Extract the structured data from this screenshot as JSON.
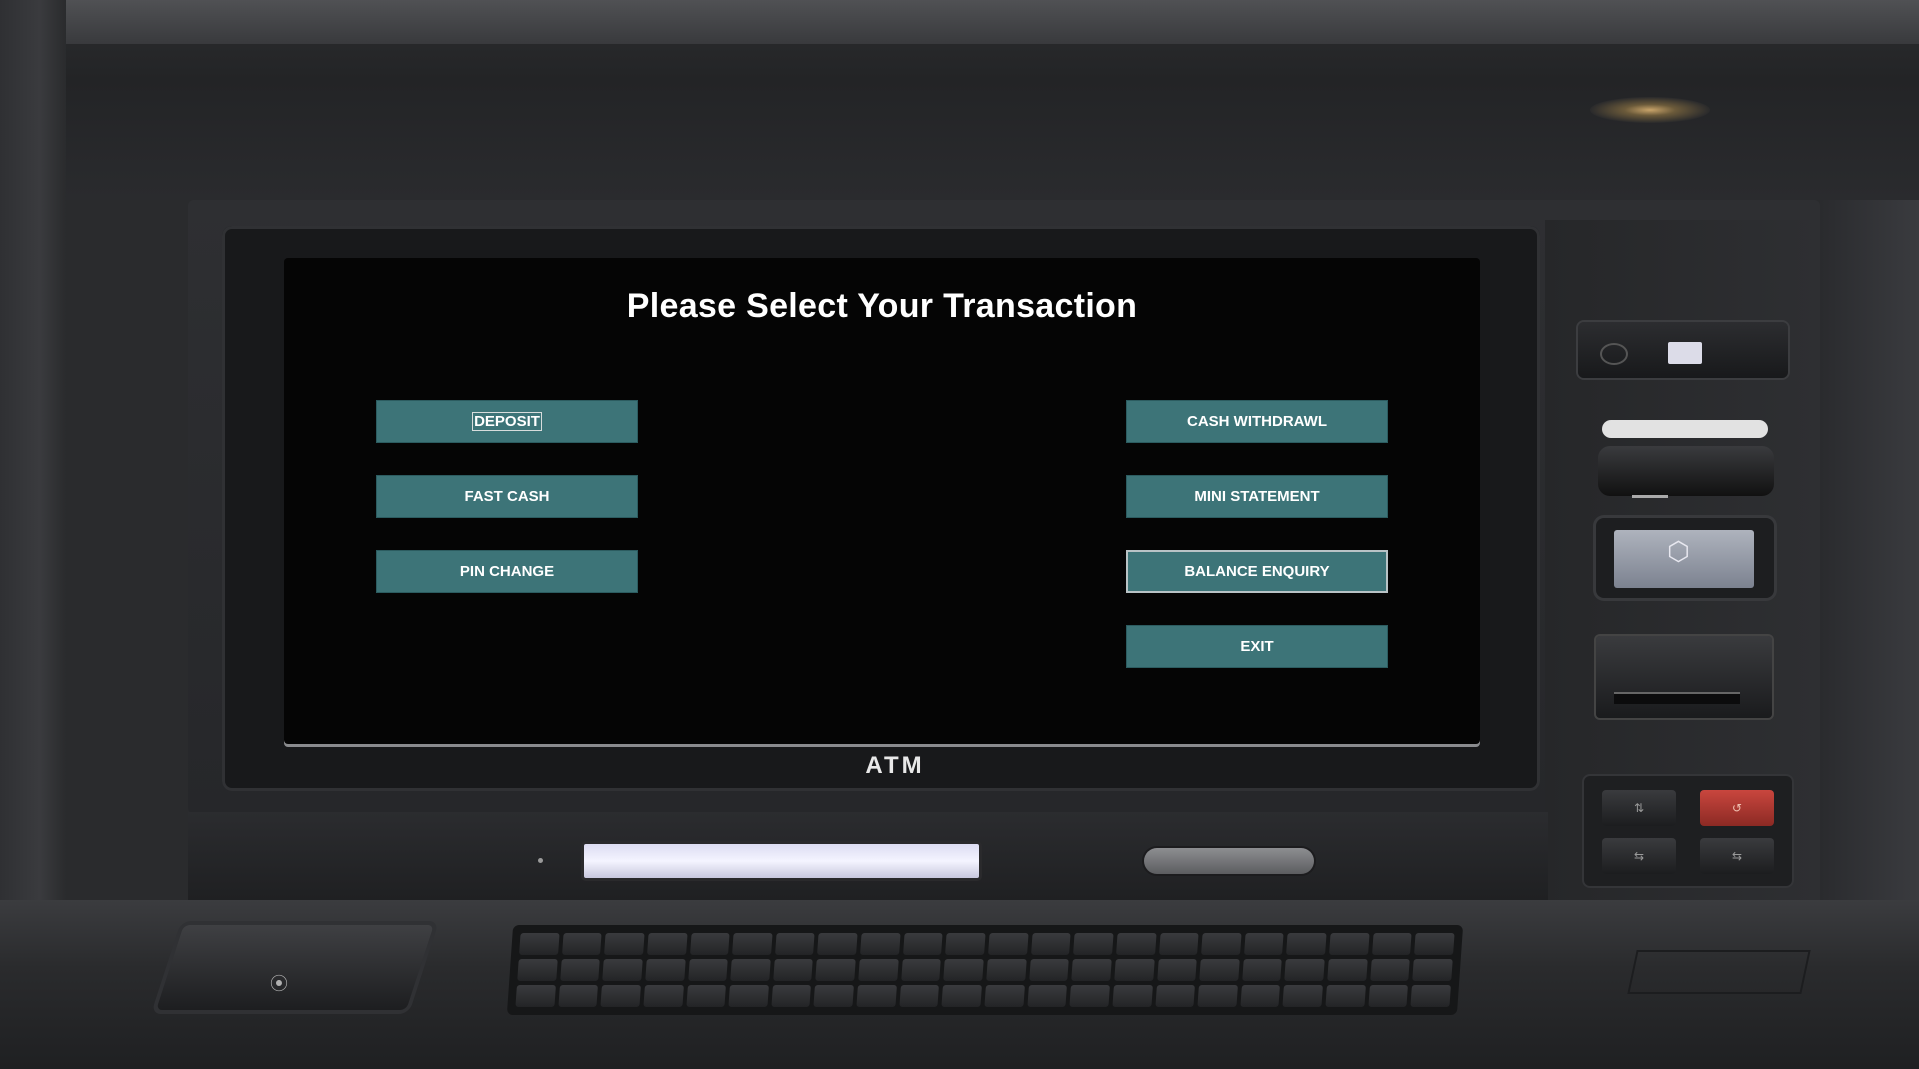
{
  "screen": {
    "title": "Please Select Your Transaction",
    "left_buttons": [
      {
        "id": "deposit",
        "label": "DEPOSIT",
        "focused": true
      },
      {
        "id": "fast-cash",
        "label": "FAST CASH"
      },
      {
        "id": "pin-change",
        "label": "PIN CHANGE"
      }
    ],
    "right_buttons": [
      {
        "id": "cash-withdrawl",
        "label": "CASH WITHDRAWL"
      },
      {
        "id": "mini-statement",
        "label": "MINI STATEMENT"
      },
      {
        "id": "balance-enquiry",
        "label": "BALANCE ENQUIRY",
        "hover": true
      },
      {
        "id": "exit",
        "label": "EXIT"
      }
    ],
    "button_color": "#3d7478",
    "background_color": "#050505"
  },
  "machine": {
    "brand_label": "ATM",
    "icons": {
      "card_reader": "card-reader-icon",
      "contactless": "contactless-icon",
      "cash_dispenser": "cash-dispenser-icon",
      "keypad": "keypad-icon",
      "cancel_key_color": "#c9463e"
    }
  }
}
